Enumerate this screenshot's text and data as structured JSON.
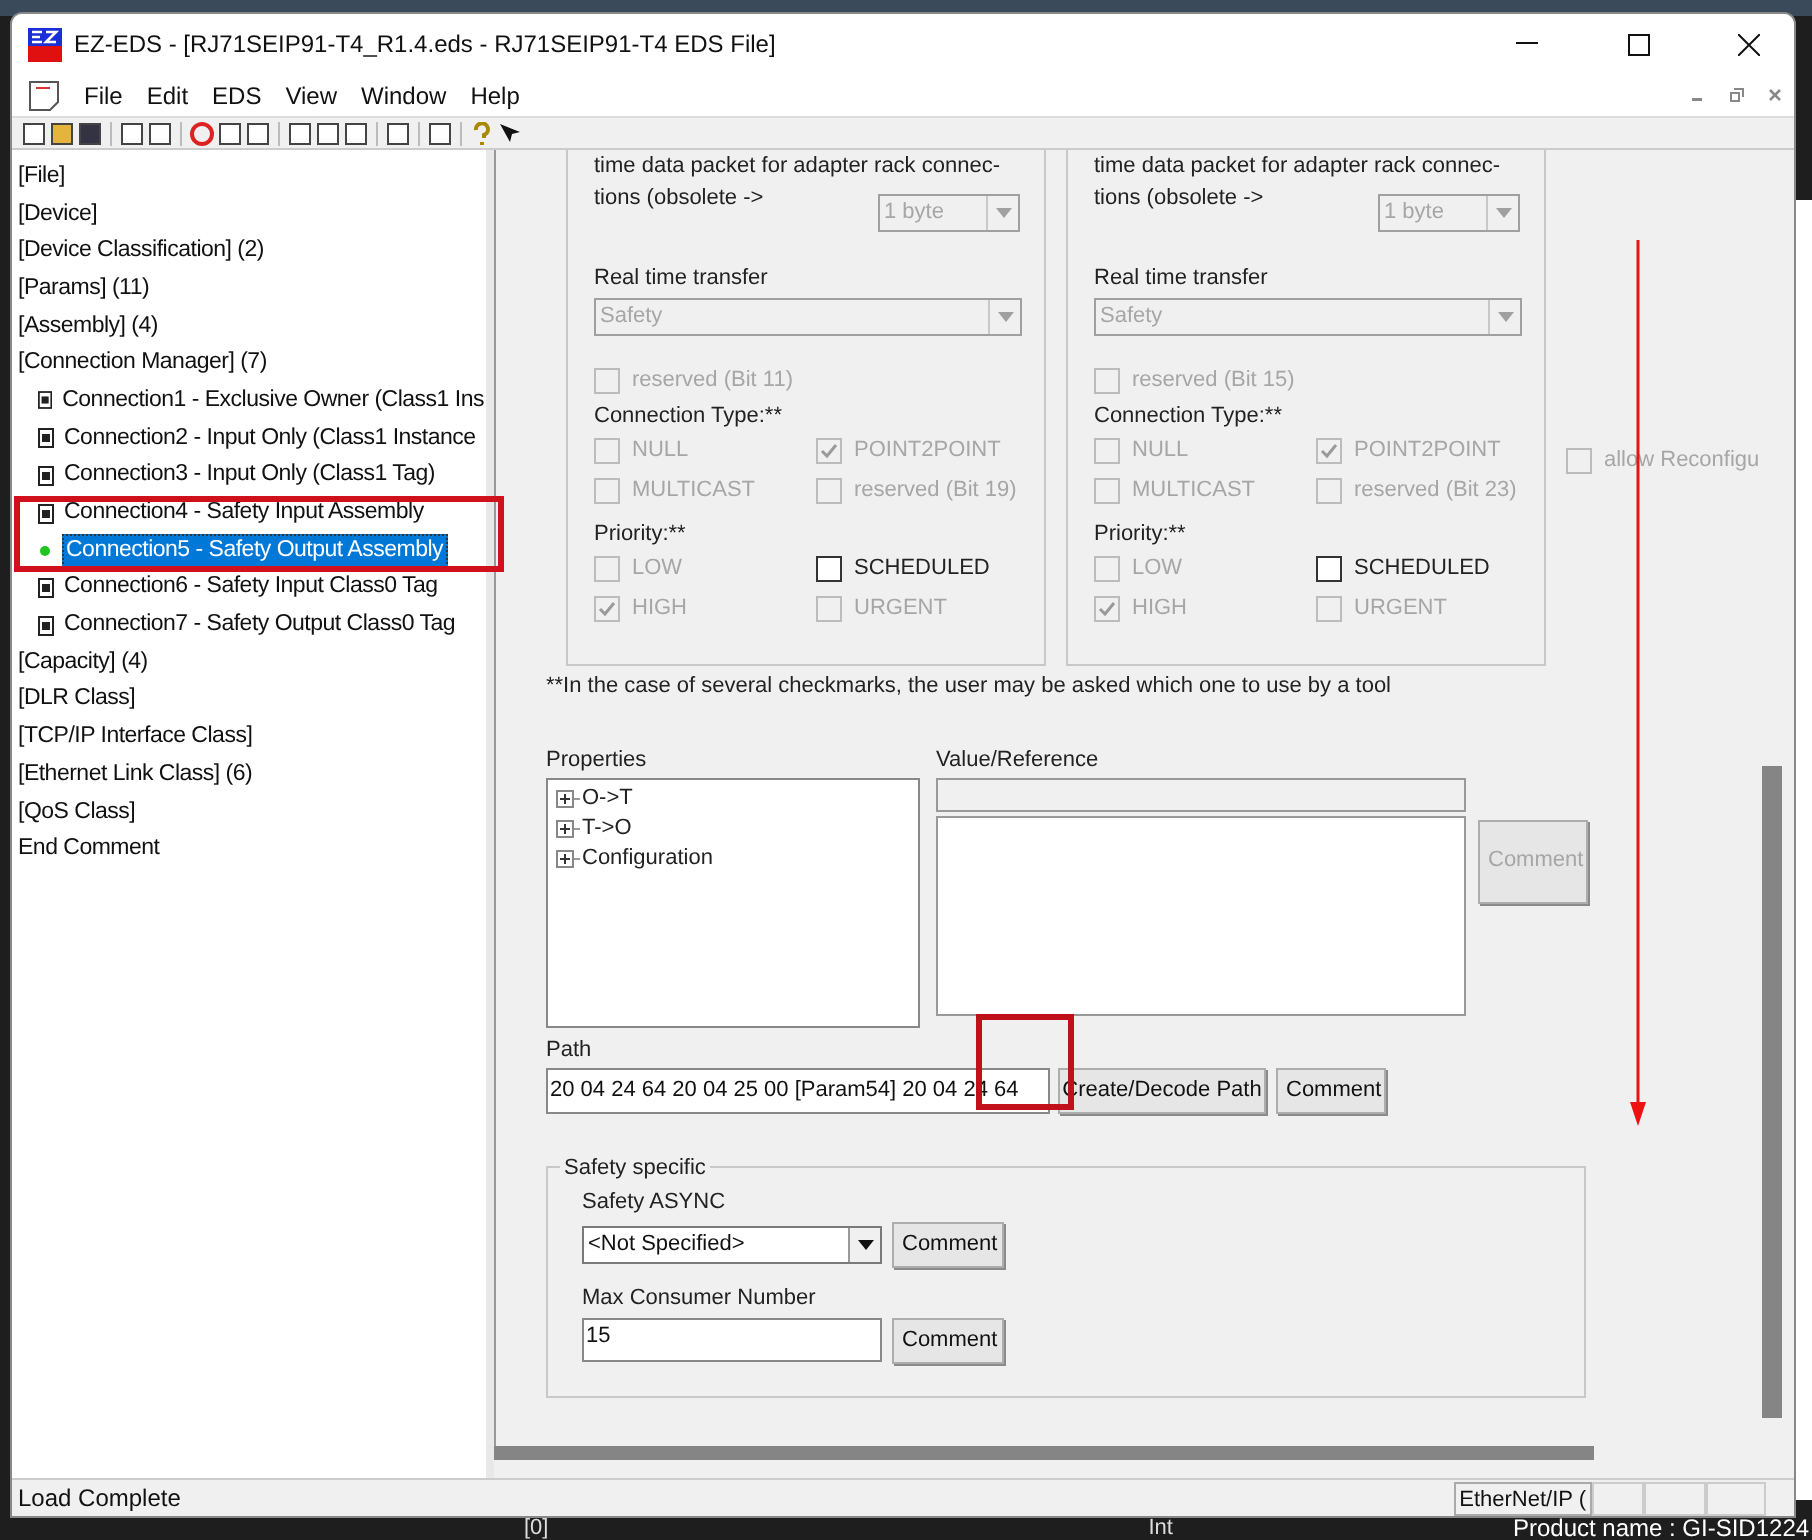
{
  "window": {
    "title": "EZ-EDS - [RJ71SEIP91-T4_R1.4.eds - RJ71SEIP91-T4 EDS File]"
  },
  "menu": [
    "File",
    "Edit",
    "EDS",
    "View",
    "Window",
    "Help"
  ],
  "tree": [
    {
      "label": "[File]",
      "selected": false
    },
    {
      "label": "[Device]",
      "selected": false
    },
    {
      "label": "[Device Classification] (2)",
      "selected": false
    },
    {
      "label": "[Params] (11)",
      "selected": false
    },
    {
      "label": "[Assembly] (4)",
      "selected": false
    },
    {
      "label": "[Connection Manager] (7)",
      "selected": false,
      "children": [
        {
          "label": "Connection1 - Exclusive Owner (Class1 Ins",
          "selected": false
        },
        {
          "label": "Connection2 - Input Only (Class1 Instance",
          "selected": false
        },
        {
          "label": "Connection3 - Input Only (Class1 Tag)",
          "selected": false
        },
        {
          "label": "Connection4 - Safety Input Assembly",
          "selected": false
        },
        {
          "label": "Connection5 - Safety Output Assembly",
          "selected": true
        },
        {
          "label": "Connection6 - Safety Input Class0 Tag",
          "selected": false
        },
        {
          "label": "Connection7 - Safety Output Class0 Tag",
          "selected": false
        }
      ]
    },
    {
      "label": "[Capacity] (4)",
      "selected": false
    },
    {
      "label": "[DLR Class]",
      "selected": false
    },
    {
      "label": "[TCP/IP Interface Class]",
      "selected": false
    },
    {
      "label": "[Ethernet Link Class] (6)",
      "selected": false
    },
    {
      "label": "[QoS Class]",
      "selected": false
    },
    {
      "label": "End Comment",
      "selected": false
    }
  ],
  "groups": [
    {
      "packet_text": [
        "time data packet for adapter rack connec-",
        "tions (obsolete ->"
      ],
      "packet_select": "1 byte",
      "realtime_label": "Real time transfer",
      "realtime_select": "Safety",
      "reserved": {
        "label": "reserved (Bit 11)",
        "checked": false,
        "disabled": true
      },
      "connection_type_label": "Connection Type:**",
      "connection_types": [
        {
          "label": "NULL",
          "checked": false,
          "disabled": true
        },
        {
          "label": "POINT2POINT",
          "checked": true,
          "disabled": true
        },
        {
          "label": "MULTICAST",
          "checked": false,
          "disabled": true
        },
        {
          "label": "reserved (Bit 19)",
          "checked": false,
          "disabled": true
        }
      ],
      "priority_label": "Priority:**",
      "priorities": [
        {
          "label": "LOW",
          "checked": false,
          "disabled": true
        },
        {
          "label": "SCHEDULED",
          "checked": false,
          "disabled": false
        },
        {
          "label": "HIGH",
          "checked": true,
          "disabled": true
        },
        {
          "label": "URGENT",
          "checked": false,
          "disabled": true
        }
      ]
    },
    {
      "packet_text": [
        "time data packet for adapter rack connec-",
        "tions (obsolete ->"
      ],
      "packet_select": "1 byte",
      "realtime_label": "Real time transfer",
      "realtime_select": "Safety",
      "reserved": {
        "label": "reserved (Bit 15)",
        "checked": false,
        "disabled": true
      },
      "connection_type_label": "Connection Type:**",
      "connection_types": [
        {
          "label": "NULL",
          "checked": false,
          "disabled": true
        },
        {
          "label": "POINT2POINT",
          "checked": true,
          "disabled": true
        },
        {
          "label": "MULTICAST",
          "checked": false,
          "disabled": true
        },
        {
          "label": "reserved (Bit 23)",
          "checked": false,
          "disabled": true
        }
      ],
      "priority_label": "Priority:**",
      "priorities": [
        {
          "label": "LOW",
          "checked": false,
          "disabled": true
        },
        {
          "label": "SCHEDULED",
          "checked": false,
          "disabled": false
        },
        {
          "label": "HIGH",
          "checked": true,
          "disabled": true
        },
        {
          "label": "URGENT",
          "checked": false,
          "disabled": true
        }
      ]
    }
  ],
  "allow_reconfig": {
    "label": "allow Reconfigu",
    "checked": false,
    "disabled": true
  },
  "footnote": "**In the case of several checkmarks, the user may be asked which one to use by a tool",
  "properties": {
    "label": "Properties",
    "items": [
      {
        "label": "O->T",
        "expanded": false
      },
      {
        "label": "T->O",
        "expanded": false
      },
      {
        "label": "Configuration",
        "expanded": false
      }
    ]
  },
  "value_reference": {
    "label": "Value/Reference",
    "comment_button": "Comment",
    "comment_disabled": true
  },
  "path": {
    "label": "Path",
    "value": "20 04 24 64 20 04 25 00 [Param54] 20 04 24 64",
    "decode_button": "Create/Decode Path",
    "comment_button": "Comment"
  },
  "safety": {
    "legend": "Safety specific",
    "async_label": "Safety ASYNC",
    "async_select": "<Not Specified>",
    "async_comment": "Comment",
    "max_label": "Max Consumer Number",
    "max_value": "15",
    "max_comment": "Comment"
  },
  "status_bar": {
    "message": "Load Complete",
    "protocol": "EtherNet/IP ("
  },
  "background": {
    "cells": [
      "[0]",
      "Int"
    ],
    "product": "Product name : GI-SID1224"
  }
}
